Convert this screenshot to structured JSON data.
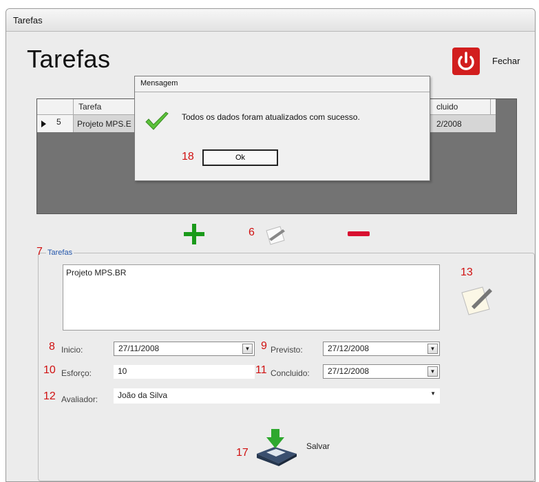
{
  "window": {
    "title": "Tarefas"
  },
  "header": {
    "title": "Tarefas",
    "close_label": "Fechar"
  },
  "grid": {
    "columns": [
      "Tarefa",
      "cluido"
    ],
    "rows": [
      {
        "row_number": "5",
        "tarefa": "Projeto MPS.E",
        "concluido": "2/2008"
      }
    ]
  },
  "dialog": {
    "title": "Mensagem",
    "message": "Todos os dados foram atualizados com sucesso.",
    "ok_label": "Ok",
    "ok_number": "18"
  },
  "toolbar": {
    "edit_number": "6"
  },
  "form": {
    "group_number": "7",
    "group_label": "Tarefas",
    "description": "Projeto MPS.BR",
    "edit_description_number": "13",
    "inicio": {
      "number": "8",
      "label": "Inicio:",
      "value": "27/11/2008"
    },
    "previsto": {
      "number": "9",
      "label": "Previsto:",
      "value": "27/12/2008"
    },
    "esforco": {
      "number": "10",
      "label": "Esforço:",
      "value": "10"
    },
    "concluido": {
      "number": "11",
      "label": "Concluido:",
      "value": "27/12/2008"
    },
    "avaliador": {
      "number": "12",
      "label": "Avaliador:",
      "value": "João da Silva"
    },
    "save": {
      "number": "17",
      "label": "Salvar"
    }
  },
  "colors": {
    "close_red": "#d21e1e",
    "add_green": "#1a9a1a",
    "remove_red": "#d81030",
    "annotation_red": "#d01010",
    "group_blue": "#2255aa"
  }
}
